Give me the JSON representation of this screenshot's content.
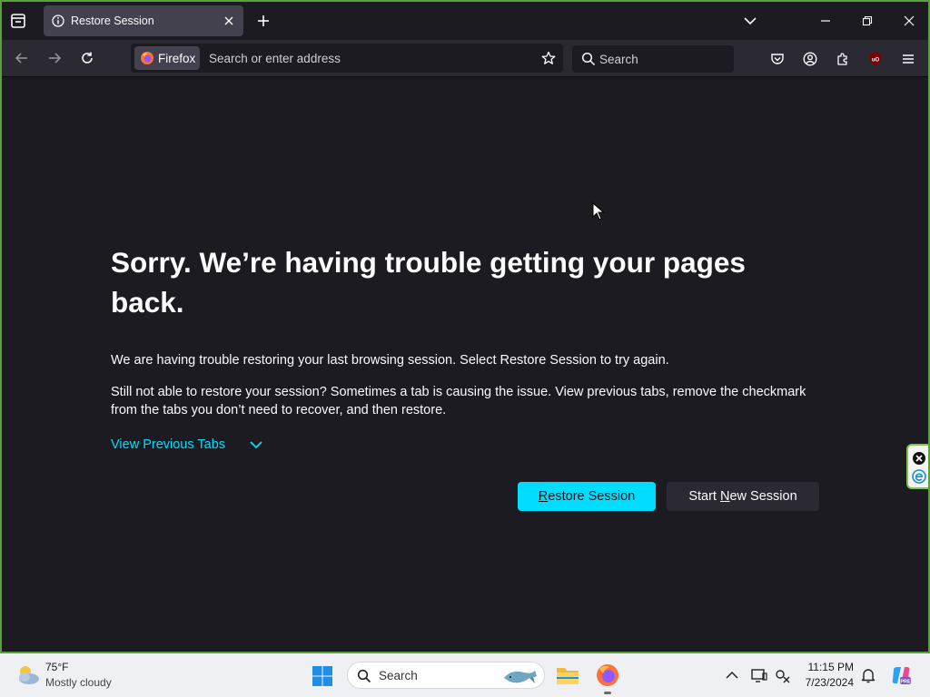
{
  "browser": {
    "tab": {
      "title": "Restore Session"
    },
    "identity_label": "Firefox",
    "url_placeholder": "Search or enter address",
    "search_placeholder": "Search"
  },
  "page": {
    "title": "Sorry. We’re having trouble getting your pages back.",
    "paragraph1": "We are having trouble restoring your last browsing session. Select Restore Session to try again.",
    "paragraph2": "Still not able to restore your session? Sometimes a tab is causing the issue. View previous tabs, remove the checkmark from the tabs you don’t need to recover, and then restore.",
    "view_previous_tabs": "View Previous Tabs",
    "restore_button": "Restore Session",
    "new_session_button": "Start New Session"
  },
  "taskbar": {
    "weather": {
      "temp": "75°F",
      "condition": "Mostly cloudy"
    },
    "search_label": "Search",
    "clock": {
      "time": "11:15 PM",
      "date": "7/23/2024"
    }
  },
  "colors": {
    "accent": "#00ddff",
    "background": "#1c1b22",
    "toolbar": "#2b2a33",
    "tab_selected": "#42414d",
    "window_border": "#5aa03c",
    "taskbar": "#eef0f3"
  },
  "icons": [
    "list-all-tabs-icon",
    "info-icon",
    "close-icon",
    "plus-icon",
    "chevron-down-icon",
    "minimize-icon",
    "restore-icon",
    "back-arrow-icon",
    "forward-arrow-icon",
    "reload-icon",
    "firefox-icon",
    "star-icon",
    "search-icon",
    "pocket-icon",
    "account-icon",
    "extensions-icon",
    "ublock-origin-icon",
    "hamburger-menu-icon",
    "weather-cloud-icon",
    "windows-start-icon",
    "file-explorer-icon",
    "copilot-icon",
    "bell-icon"
  ]
}
